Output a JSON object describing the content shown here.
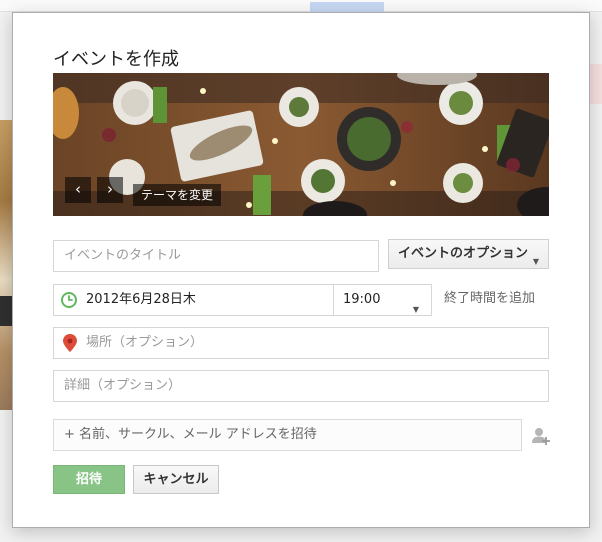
{
  "dialog": {
    "title": "イベントを作成"
  },
  "banner": {
    "prev_label": "‹",
    "next_label": "›",
    "change_theme_label": "テーマを変更"
  },
  "form": {
    "title_placeholder": "イベントのタイトル",
    "options_button_label": "イベントのオプション",
    "date_value": "2012年6月28日木",
    "time_value": "19:00",
    "add_end_time_label": "終了時間を追加",
    "location_placeholder": "場所（オプション）",
    "details_placeholder": "詳細（オプション）",
    "invite_placeholder": "+ 名前、サークル、メール アドレスを招待"
  },
  "actions": {
    "invite_label": "招待",
    "cancel_label": "キャンセル"
  },
  "colors": {
    "invite_button": "#89c487",
    "clock_icon": "#5fb85f",
    "pin_icon": "#dd4b39"
  }
}
